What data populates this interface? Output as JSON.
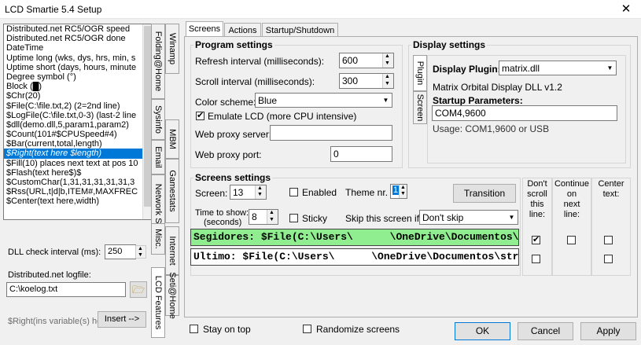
{
  "window": {
    "title": "LCD Smartie 5.4 Setup",
    "close_glyph": "✕"
  },
  "variables": [
    "Distributed.net RC5/OGR speed",
    "Distributed.net RC5/OGR done",
    "DateTime",
    "Uptime long (wks, dys, hrs, min, s",
    "Uptime short (days, hours, minute",
    "Degree symbol (°)",
    "Block (█)",
    "$Chr(20)",
    "$File(C:\\file.txt,2)  (2=2nd line)",
    "$LogFile(C:\\file.txt,0-3) (last-2 line",
    "$dll(demo.dll,5,param1,param2)",
    "$Count(101#$CPUSpeed#4)",
    "$Bar(current,total,length)",
    "$Right(text here $length)",
    "$Fill(10) places next text at pos 10",
    "$Flash(text here$)$",
    "$CustomChar(1,31,31,31,31,31,3",
    "$Rss(URL,t|d|b,ITEM#,MAXFREC",
    "$Center(text here,width)"
  ],
  "selected_variable_index": 13,
  "left_vtabs": [
    "Folding@Home",
    "Sysinfo",
    "Email",
    "Network Stats",
    "Misc."
  ],
  "right_vtabs": [
    "Winamp",
    "MBM",
    "Gamestats",
    "Internet",
    "Seti@Home",
    "LCD Features"
  ],
  "dll_check": {
    "label": "DLL check interval (ms):",
    "value": "250"
  },
  "dnet_logfile": {
    "label": "Distributed.net logfile:",
    "value": "C:\\koelog.txt"
  },
  "insert": {
    "hint": "$Right(ins variable(s) here",
    "button": "Insert -->"
  },
  "tabs": [
    "Screens",
    "Actions",
    "Startup/Shutdown"
  ],
  "program_settings": {
    "title": "Program settings",
    "refresh_label": "Refresh interval (milliseconds):",
    "refresh_value": "600",
    "scroll_label": "Scroll interval (milliseconds):",
    "scroll_value": "300",
    "color_label": "Color scheme:",
    "color_value": "Blue",
    "emulate_label": "Emulate LCD   (more CPU intensive)",
    "emulate_checked": true,
    "proxy_server_label": "Web proxy server:",
    "proxy_server_value": "",
    "proxy_port_label": "Web proxy port:",
    "proxy_port_value": "0"
  },
  "display_settings": {
    "title": "Display settings",
    "vtabs": [
      "Plugin",
      "Screen"
    ],
    "plugin_label": "Display Plugin:",
    "plugin_value": "matrix.dll",
    "plugin_desc": "Matrix Orbital Display DLL v1.2",
    "startup_label": "Startup Parameters:",
    "startup_value": "COM4,9600",
    "usage": "Usage: COM1,9600 or USB"
  },
  "screens_settings": {
    "title": "Screens settings",
    "screen_label": "Screen:",
    "screen_value": "13",
    "enabled_label": "Enabled",
    "enabled_checked": false,
    "theme_label": "Theme nr.",
    "theme_value": "1",
    "transition_button": "Transition",
    "time_label_1": "Time to show:",
    "time_label_2": "(seconds)",
    "time_value": "8",
    "sticky_label": "Sticky",
    "sticky_checked": false,
    "skip_label": "Skip this screen if:",
    "skip_value": "Don't skip",
    "lines": [
      {
        "text": "Segidores: $File(C:\\Users\\      \\OneDrive\\Documentos\\",
        "dont_scroll": true,
        "continue_next": false,
        "center": false
      },
      {
        "text": "Ultimo: $File(C:\\Users\\      \\OneDrive\\Documentos\\str",
        "dont_scroll": false,
        "continue_next": false,
        "center": false
      }
    ],
    "col_dont_scroll": [
      "Don't",
      "scroll",
      "this",
      "line:"
    ],
    "col_continue": [
      "Continue",
      "on",
      "next",
      "line:"
    ],
    "col_center": [
      "Center",
      "text:"
    ]
  },
  "bottom": {
    "stay_on_top_label": "Stay on top",
    "stay_on_top_checked": false,
    "randomize_label": "Randomize screens",
    "randomize_checked": false,
    "ok": "OK",
    "cancel": "Cancel",
    "apply": "Apply"
  },
  "colors": {
    "accent": "#0078d7",
    "line1_bg": "#90ee90"
  },
  "icons": {
    "folder": "folder-open-icon",
    "dropdown": "chevron-down-icon"
  }
}
